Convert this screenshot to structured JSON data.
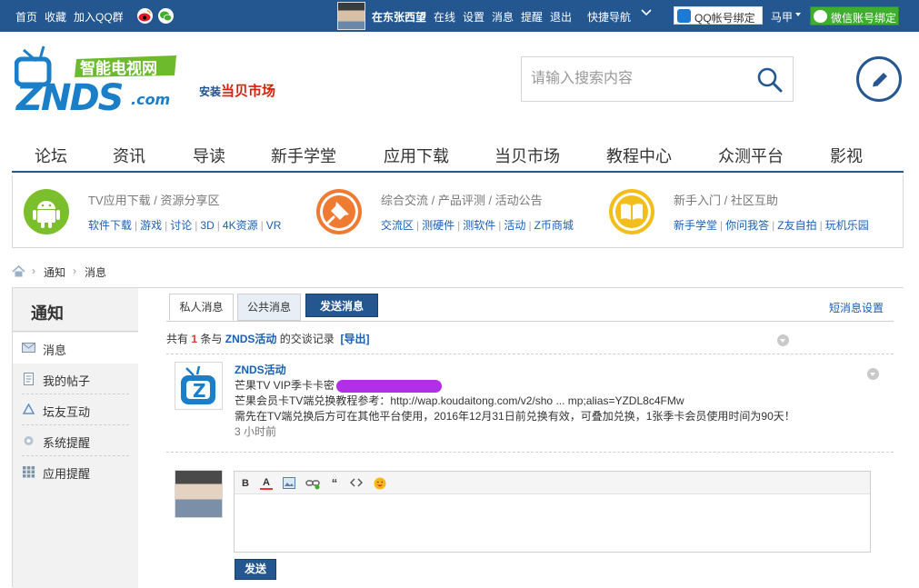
{
  "topbar": {
    "home": "首页",
    "favorite": "收藏",
    "join_qq": "加入QQ群",
    "icons": [
      "weibo-icon",
      "wechat-icon"
    ],
    "username": "在东张西望",
    "online": "在线",
    "settings": "设置",
    "messages": "消息",
    "reminders": "提醒",
    "logout": "退出",
    "quick_nav": "快捷导航",
    "qq_bind": "QQ帐号绑定",
    "mafu": "马甲",
    "wechat_bind": "微信账号绑定"
  },
  "header": {
    "logo_tag": "智能电视网",
    "logo_text": "ZNDS.com",
    "install": "安装",
    "market": "当贝市场",
    "search_placeholder": "请输入搜索内容",
    "search_icon": "search-icon",
    "post_icon": "pencil-icon"
  },
  "nav": [
    "论坛",
    "资讯",
    "导读",
    "新手学堂",
    "应用下载",
    "当贝市场",
    "教程中心",
    "众测平台",
    "影视"
  ],
  "categories": [
    {
      "icon": "android-icon",
      "title": "TV应用下载 / 资源分享区",
      "links": [
        "软件下载",
        "游戏",
        "讨论",
        "3D",
        "4K资源",
        "VR"
      ]
    },
    {
      "icon": "pin-icon",
      "title": "综合交流 / 产品评测 / 活动公告",
      "links": [
        "交流区",
        "测硬件",
        "测软件",
        "活动",
        "Z币商城"
      ]
    },
    {
      "icon": "book-icon",
      "title": "新手入门 / 社区互助",
      "links": [
        "新手学堂",
        "你问我答",
        "Z友自拍",
        "玩机乐园"
      ]
    }
  ],
  "breadcrumb": [
    "通知",
    "消息"
  ],
  "sidebar": {
    "title": "通知",
    "items": [
      {
        "label": "消息",
        "icon": "envelope-icon"
      },
      {
        "label": "我的帖子",
        "icon": "document-icon"
      },
      {
        "label": "坛友互动",
        "icon": "recycle-icon"
      },
      {
        "label": "系统提醒",
        "icon": "gear-icon"
      },
      {
        "label": "应用提醒",
        "icon": "grid-icon"
      }
    ]
  },
  "tabs": {
    "private": "私人消息",
    "public": "公共消息",
    "send": "发送消息",
    "settings": "短消息设置"
  },
  "summary": {
    "prefix": "共有",
    "count": "1",
    "middle": "条与",
    "sender": "ZNDS活动",
    "suffix": "的交谈记录",
    "export": "[导出]"
  },
  "message": {
    "sender": "ZNDS活动",
    "line1": "芒果TV VIP季卡卡密",
    "line2": "芒果会员卡TV端兑换教程参考：http://wap.koudaitong.com/v2/sho ... mp;alias=YZDL8c4FMw",
    "line3": "需先在TV端兑换后方可在其他平台使用，2016年12月31日前兑换有效，可叠加兑换，1张季卡会员使用时间为90天！",
    "time": "3 小时前"
  },
  "editor": {
    "toolbar": [
      "B",
      "A",
      "image-icon",
      "link-icon",
      "“",
      "code-icon",
      "smiley-icon"
    ],
    "send": "发送"
  },
  "colors": {
    "brand_blue": "#24568f",
    "link_blue": "#1a5fb4",
    "wechat_green": "#3daf2c",
    "accent_red": "#d81e06",
    "redaction_purple": "#b12fe6"
  }
}
